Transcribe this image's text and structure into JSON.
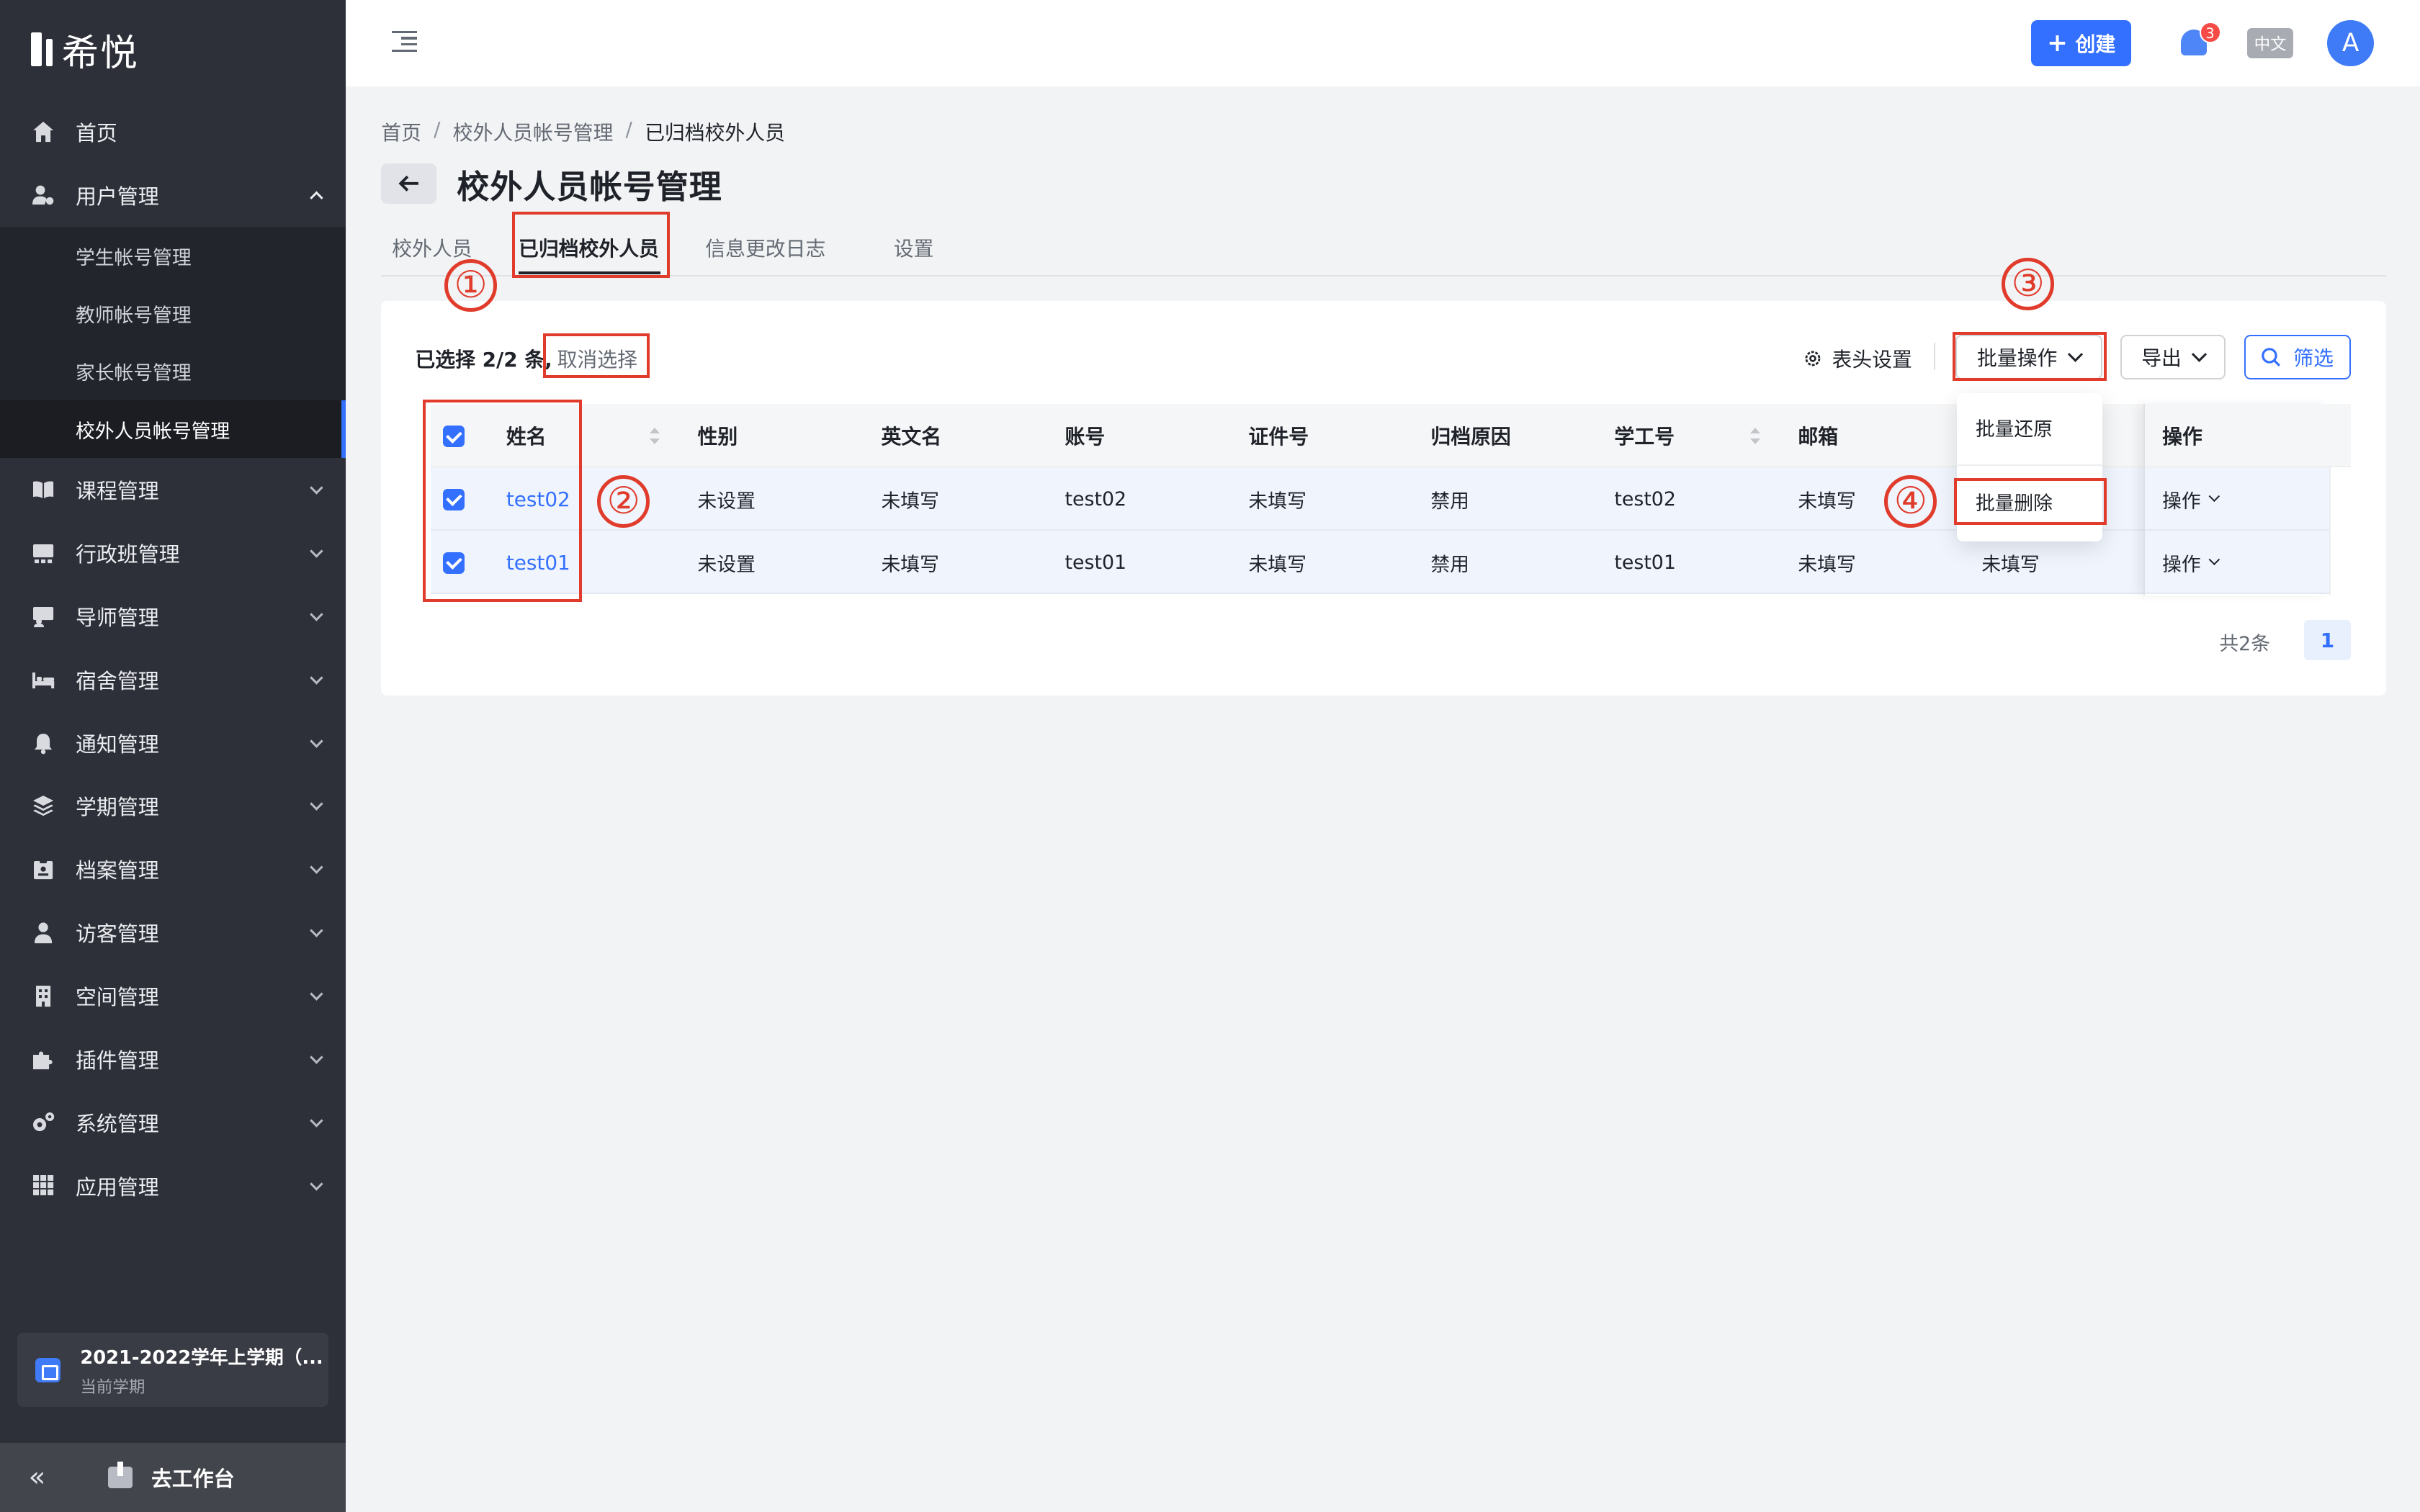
{
  "app": {
    "logo_text": "希悦"
  },
  "sidebar": {
    "items": [
      {
        "label": "首页",
        "icon": "home-icon"
      },
      {
        "label": "用户管理",
        "icon": "user-gear-icon",
        "expanded": true,
        "children": [
          "学生帐号管理",
          "教师帐号管理",
          "家长帐号管理",
          "校外人员帐号管理"
        ],
        "active_child": "校外人员帐号管理"
      },
      {
        "label": "课程管理",
        "icon": "book-icon"
      },
      {
        "label": "行政班管理",
        "icon": "class-icon"
      },
      {
        "label": "导师管理",
        "icon": "mentor-icon"
      },
      {
        "label": "宿舍管理",
        "icon": "bed-icon"
      },
      {
        "label": "通知管理",
        "icon": "bell-icon"
      },
      {
        "label": "学期管理",
        "icon": "layers-icon"
      },
      {
        "label": "档案管理",
        "icon": "file-icon"
      },
      {
        "label": "访客管理",
        "icon": "visitor-icon"
      },
      {
        "label": "空间管理",
        "icon": "building-icon"
      },
      {
        "label": "插件管理",
        "icon": "puzzle-icon"
      },
      {
        "label": "系统管理",
        "icon": "gears-icon"
      },
      {
        "label": "应用管理",
        "icon": "grid-icon"
      }
    ],
    "term": {
      "title": "2021-2022学年上学期（...",
      "subtitle": "当前学期"
    },
    "collapse_symbol": "«",
    "workbench_label": "去工作台"
  },
  "topbar": {
    "create_label": "创建",
    "notification_count": "3",
    "language": "中文",
    "avatar_letter": "A"
  },
  "breadcrumb": [
    "首页",
    "校外人员帐号管理",
    "已归档校外人员"
  ],
  "page_title": "校外人员帐号管理",
  "tabs": [
    "校外人员",
    "已归档校外人员",
    "信息更改日志",
    "设置"
  ],
  "active_tab": "已归档校外人员",
  "toolbar": {
    "selection_text": "已选择 2/2 条,",
    "cancel_selection": "取消选择",
    "column_settings": "表头设置",
    "batch_label": "批量操作",
    "export_label": "导出",
    "filter_label": "筛选"
  },
  "dropdown": {
    "items": [
      "批量还原",
      "批量删除"
    ]
  },
  "table": {
    "columns": [
      "姓名",
      "性别",
      "英文名",
      "账号",
      "证件号",
      "归档原因",
      "学工号",
      "邮箱",
      "",
      "操作"
    ],
    "rows": [
      {
        "name": "test02",
        "gender": "未设置",
        "english_name": "未填写",
        "account": "test02",
        "id_no": "未填写",
        "reason": "禁用",
        "staff_no": "test02",
        "email": "未填写",
        "extra": "",
        "op": "操作"
      },
      {
        "name": "test01",
        "gender": "未设置",
        "english_name": "未填写",
        "account": "test01",
        "id_no": "未填写",
        "reason": "禁用",
        "staff_no": "test01",
        "email": "未填写",
        "extra": "未填写",
        "op": "操作"
      }
    ]
  },
  "pagination": {
    "total": "共2条",
    "current": "1"
  },
  "annotations": [
    "①",
    "②",
    "③",
    "④"
  ],
  "colors": {
    "primary": "#3370ff",
    "sidebar_bg": "#2e3039",
    "annotation": "#e03b2b"
  }
}
